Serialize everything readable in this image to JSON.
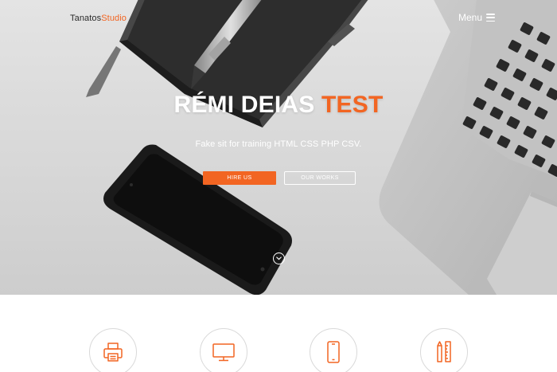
{
  "header": {
    "brand_part1": "Tanatos",
    "brand_part2": "Studio",
    "menu_label": "Menu",
    "menu_icon": "hamburger-icon"
  },
  "hero": {
    "title_main": "RÉMI DEIAS ",
    "title_accent": "TEST",
    "subtitle": "Fake sit for training HTML CSS PHP CSV.",
    "hire_button": "HIRE US",
    "work_button": "OUR WORKS",
    "scroll_icon": "chevron-down-circle-icon"
  },
  "services": {
    "icons": [
      "printer-icon",
      "monitor-icon",
      "smartphone-icon",
      "pencil-ruler-icon"
    ]
  },
  "colors": {
    "accent": "#f26522",
    "text_on_hero": "#ffffff",
    "circle_border": "#d9d9d9"
  }
}
